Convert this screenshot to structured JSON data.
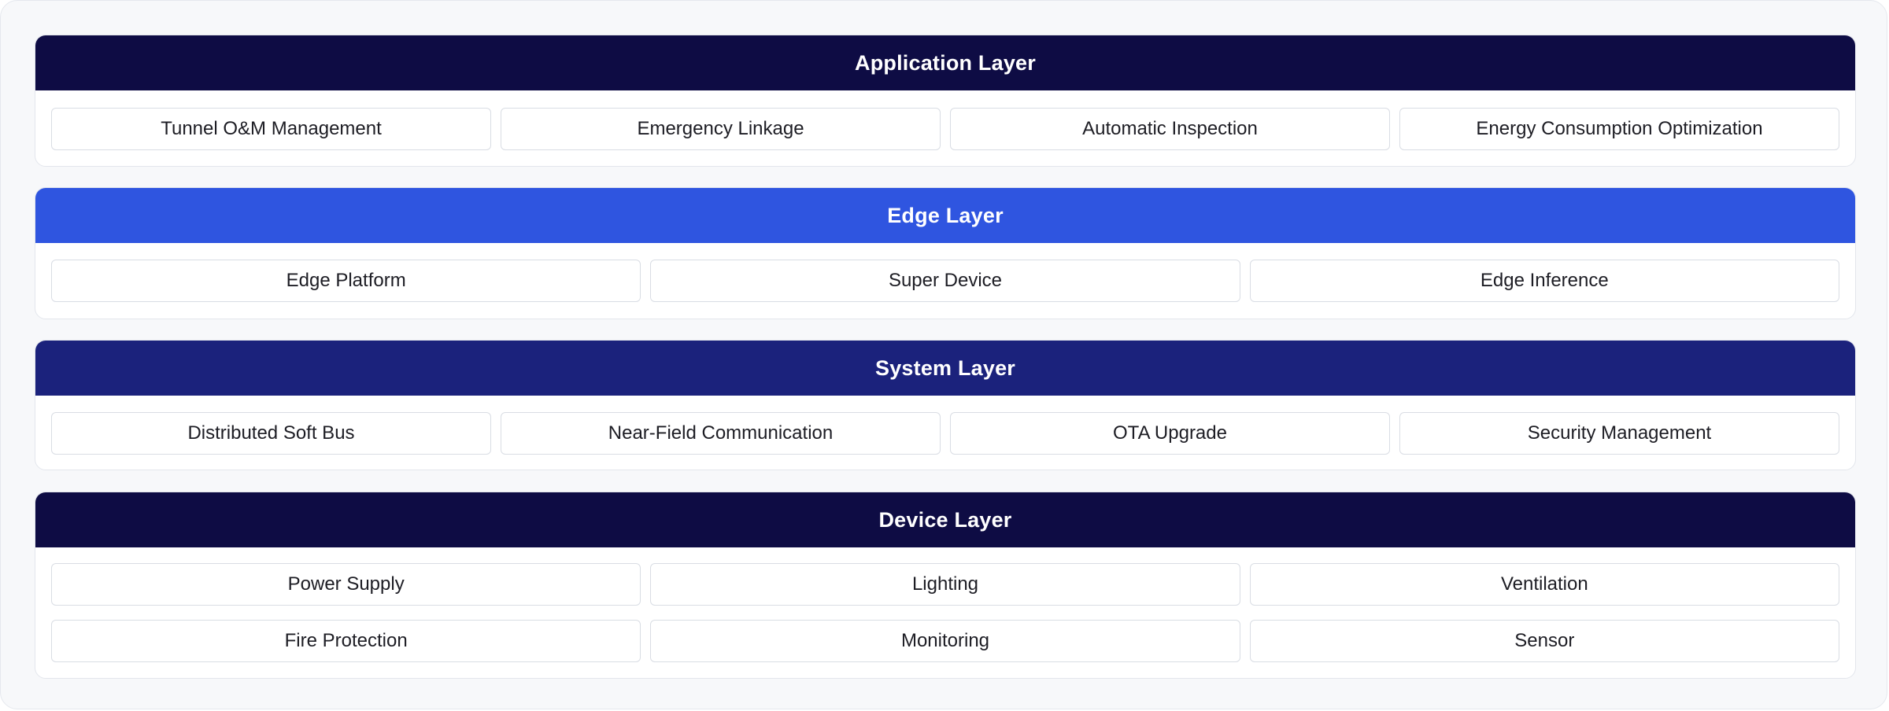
{
  "layers": [
    {
      "title": "Application Layer",
      "color": "#0e0c44",
      "items": [
        "Tunnel O&M Management",
        "Emergency Linkage",
        "Automatic Inspection",
        "Energy Consumption Optimization"
      ]
    },
    {
      "title": "Edge Layer",
      "color": "#2f55e0",
      "items": [
        "Edge Platform",
        "Super Device",
        "Edge Inference"
      ]
    },
    {
      "title": "System Layer",
      "color": "#1b227c",
      "items": [
        "Distributed Soft Bus",
        "Near-Field Communication",
        "OTA Upgrade",
        "Security Management"
      ]
    },
    {
      "title": "Device Layer",
      "color": "#0e0c44",
      "items": [
        "Power Supply",
        "Lighting",
        "Ventilation",
        "Fire Protection",
        "Monitoring",
        "Sensor"
      ]
    }
  ]
}
